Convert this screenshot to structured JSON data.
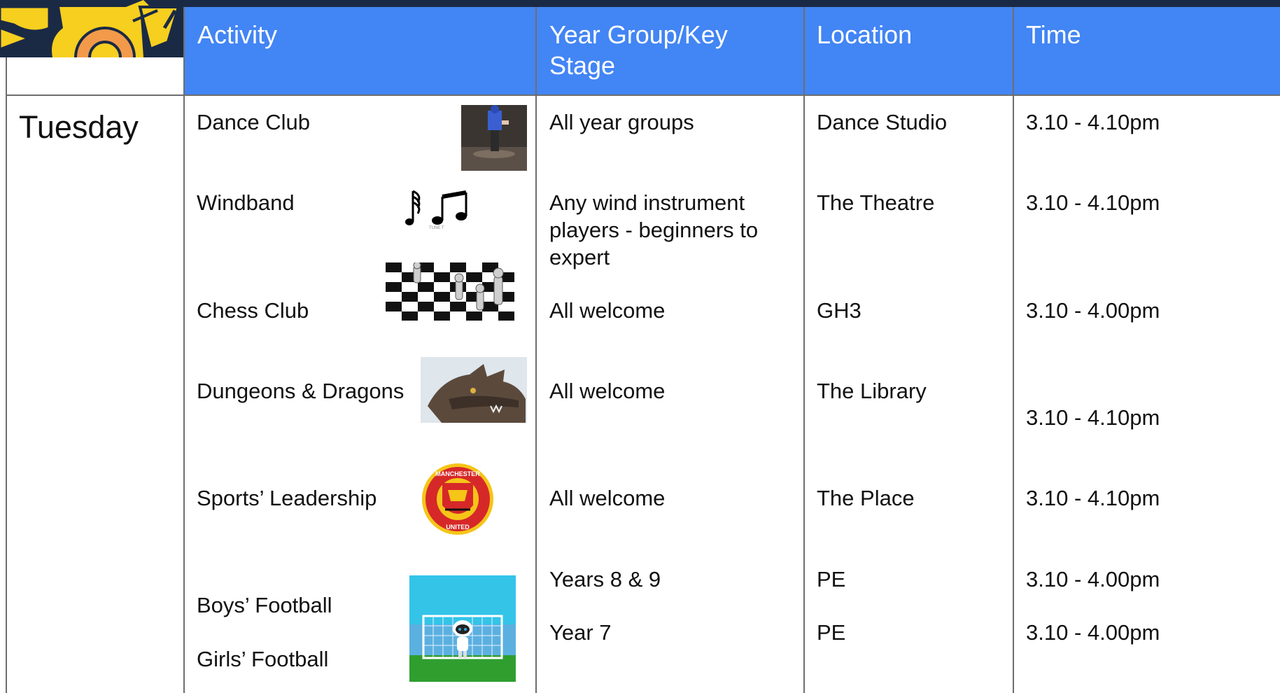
{
  "header": {
    "activity": "Activity",
    "year_group_line1": "Year Group/Key",
    "year_group_line2": "Stage",
    "location": "Location",
    "time": "Time"
  },
  "day": "Tuesday",
  "rows": [
    {
      "activity": "Dance Club",
      "year": "All year groups",
      "location": "Dance Studio",
      "time": "3.10 - 4.10pm",
      "icon": "dance-photo"
    },
    {
      "activity": "Windband",
      "year_line1": "Any wind instrument",
      "year_line2": "players - beginners to",
      "year_line3": "expert",
      "location": "The Theatre",
      "time": "3.10 - 4.10pm",
      "icon": "music-notes"
    },
    {
      "activity": "Chess Club",
      "year": "All welcome",
      "location": "GH3",
      "time": "3.10 - 4.00pm",
      "icon": "chessboard"
    },
    {
      "activity": "Dungeons & Dragons",
      "year": "All welcome",
      "location": "The Library",
      "time": "3.10 - 4.10pm",
      "icon": "dragon"
    },
    {
      "activity": "Sports’ Leadership",
      "year": "All welcome",
      "location": "The Place",
      "time": "3.10 - 4.10pm",
      "icon": "football-club-crest"
    },
    {
      "activity": "Boys’ Football",
      "year": "Years 8 & 9",
      "location": "PE",
      "time": "3.10 - 4.00pm",
      "icon": "robot-goalkeeper"
    },
    {
      "activity": "Girls’ Football",
      "year": "Year 7",
      "location": "PE",
      "time": "3.10 - 4.00pm"
    }
  ],
  "colors": {
    "header": "#4285f4",
    "topbar": "#1b2a44",
    "logo_yellow": "#f6cf1f",
    "logo_orange": "#f29a4a"
  },
  "logo_text": {
    "crest_top": "MANCHESTER",
    "crest_bottom": "UNITED",
    "music_label": "TUNE T"
  }
}
